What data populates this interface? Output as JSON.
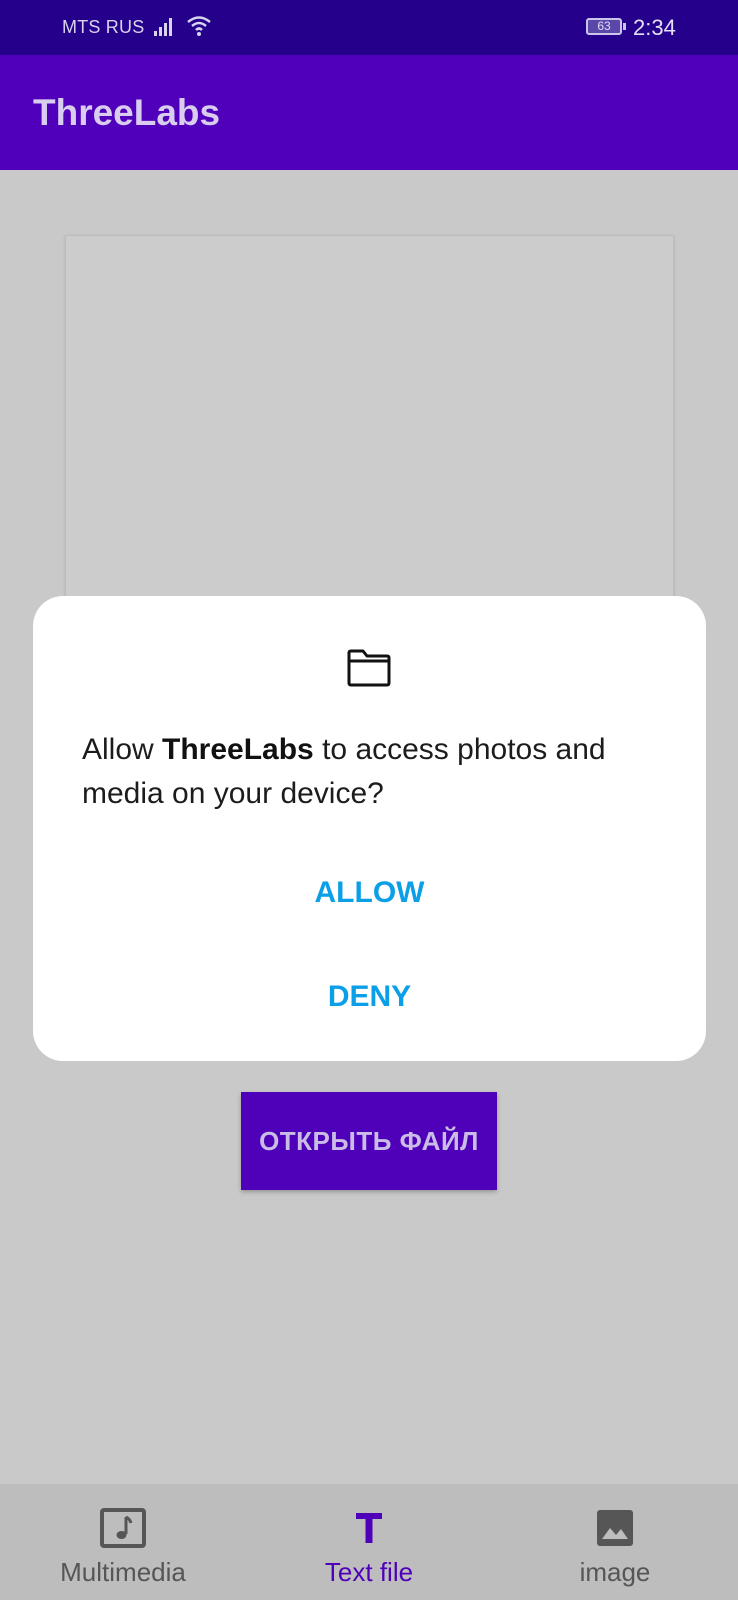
{
  "status_bar": {
    "carrier": "MTS RUS",
    "battery_level": "63",
    "time": "2:34",
    "icons": [
      "signal-icon",
      "wifi-icon",
      "battery-icon"
    ]
  },
  "app_bar": {
    "title": "ThreeLabs"
  },
  "main": {
    "open_file_label": "ОТКРЫТЬ ФАЙЛ"
  },
  "dialog": {
    "icon": "folder-icon",
    "message_prefix": "Allow ",
    "app_name": "ThreeLabs",
    "message_suffix": " to access photos and media on your device?",
    "allow_label": "ALLOW",
    "deny_label": "DENY"
  },
  "bottom_nav": {
    "items": [
      {
        "label": "Multimedia",
        "icon": "music-note-icon",
        "active": false
      },
      {
        "label": "Text file",
        "icon": "text-t-icon",
        "active": true
      },
      {
        "label": "image",
        "icon": "image-icon",
        "active": false
      }
    ]
  },
  "colors": {
    "status_bar": "#24008b",
    "primary": "#5000ba",
    "dialog_button": "#0a9fe6",
    "background": "#c9c9c9"
  }
}
